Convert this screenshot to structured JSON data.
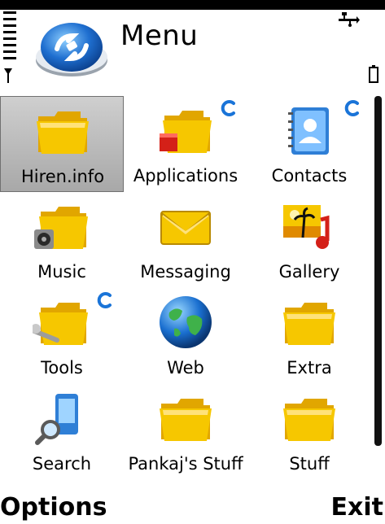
{
  "header": {
    "title": "Menu"
  },
  "status": {
    "signal_icon": "signal-strength-icon",
    "battery_icon": "battery-icon",
    "connection_icon": "usb-connection-icon"
  },
  "colors": {
    "folder": "#f6c700",
    "selection": "#b9b9b9",
    "badge": "#1a74d8"
  },
  "grid": {
    "items": [
      {
        "label": "Hiren.info",
        "icon": "folder-icon",
        "selected": true,
        "badge": false
      },
      {
        "label": "Applications",
        "icon": "applications-folder-icon",
        "selected": false,
        "badge": true
      },
      {
        "label": "Contacts",
        "icon": "contacts-icon",
        "selected": false,
        "badge": true
      },
      {
        "label": "Music",
        "icon": "music-folder-icon",
        "selected": false,
        "badge": false
      },
      {
        "label": "Messaging",
        "icon": "messaging-envelope-icon",
        "selected": false,
        "badge": false
      },
      {
        "label": "Gallery",
        "icon": "gallery-icon",
        "selected": false,
        "badge": false
      },
      {
        "label": "Tools",
        "icon": "tools-folder-icon",
        "selected": false,
        "badge": true
      },
      {
        "label": "Web",
        "icon": "web-globe-icon",
        "selected": false,
        "badge": false
      },
      {
        "label": "Extra",
        "icon": "folder-icon",
        "selected": false,
        "badge": false
      },
      {
        "label": "Search",
        "icon": "search-icon",
        "selected": false,
        "badge": false
      },
      {
        "label": "Pankaj's Stuff",
        "icon": "folder-icon",
        "selected": false,
        "badge": false
      },
      {
        "label": "Stuff",
        "icon": "folder-icon",
        "selected": false,
        "badge": false
      }
    ]
  },
  "softkeys": {
    "left": "Options",
    "right": "Exit"
  }
}
